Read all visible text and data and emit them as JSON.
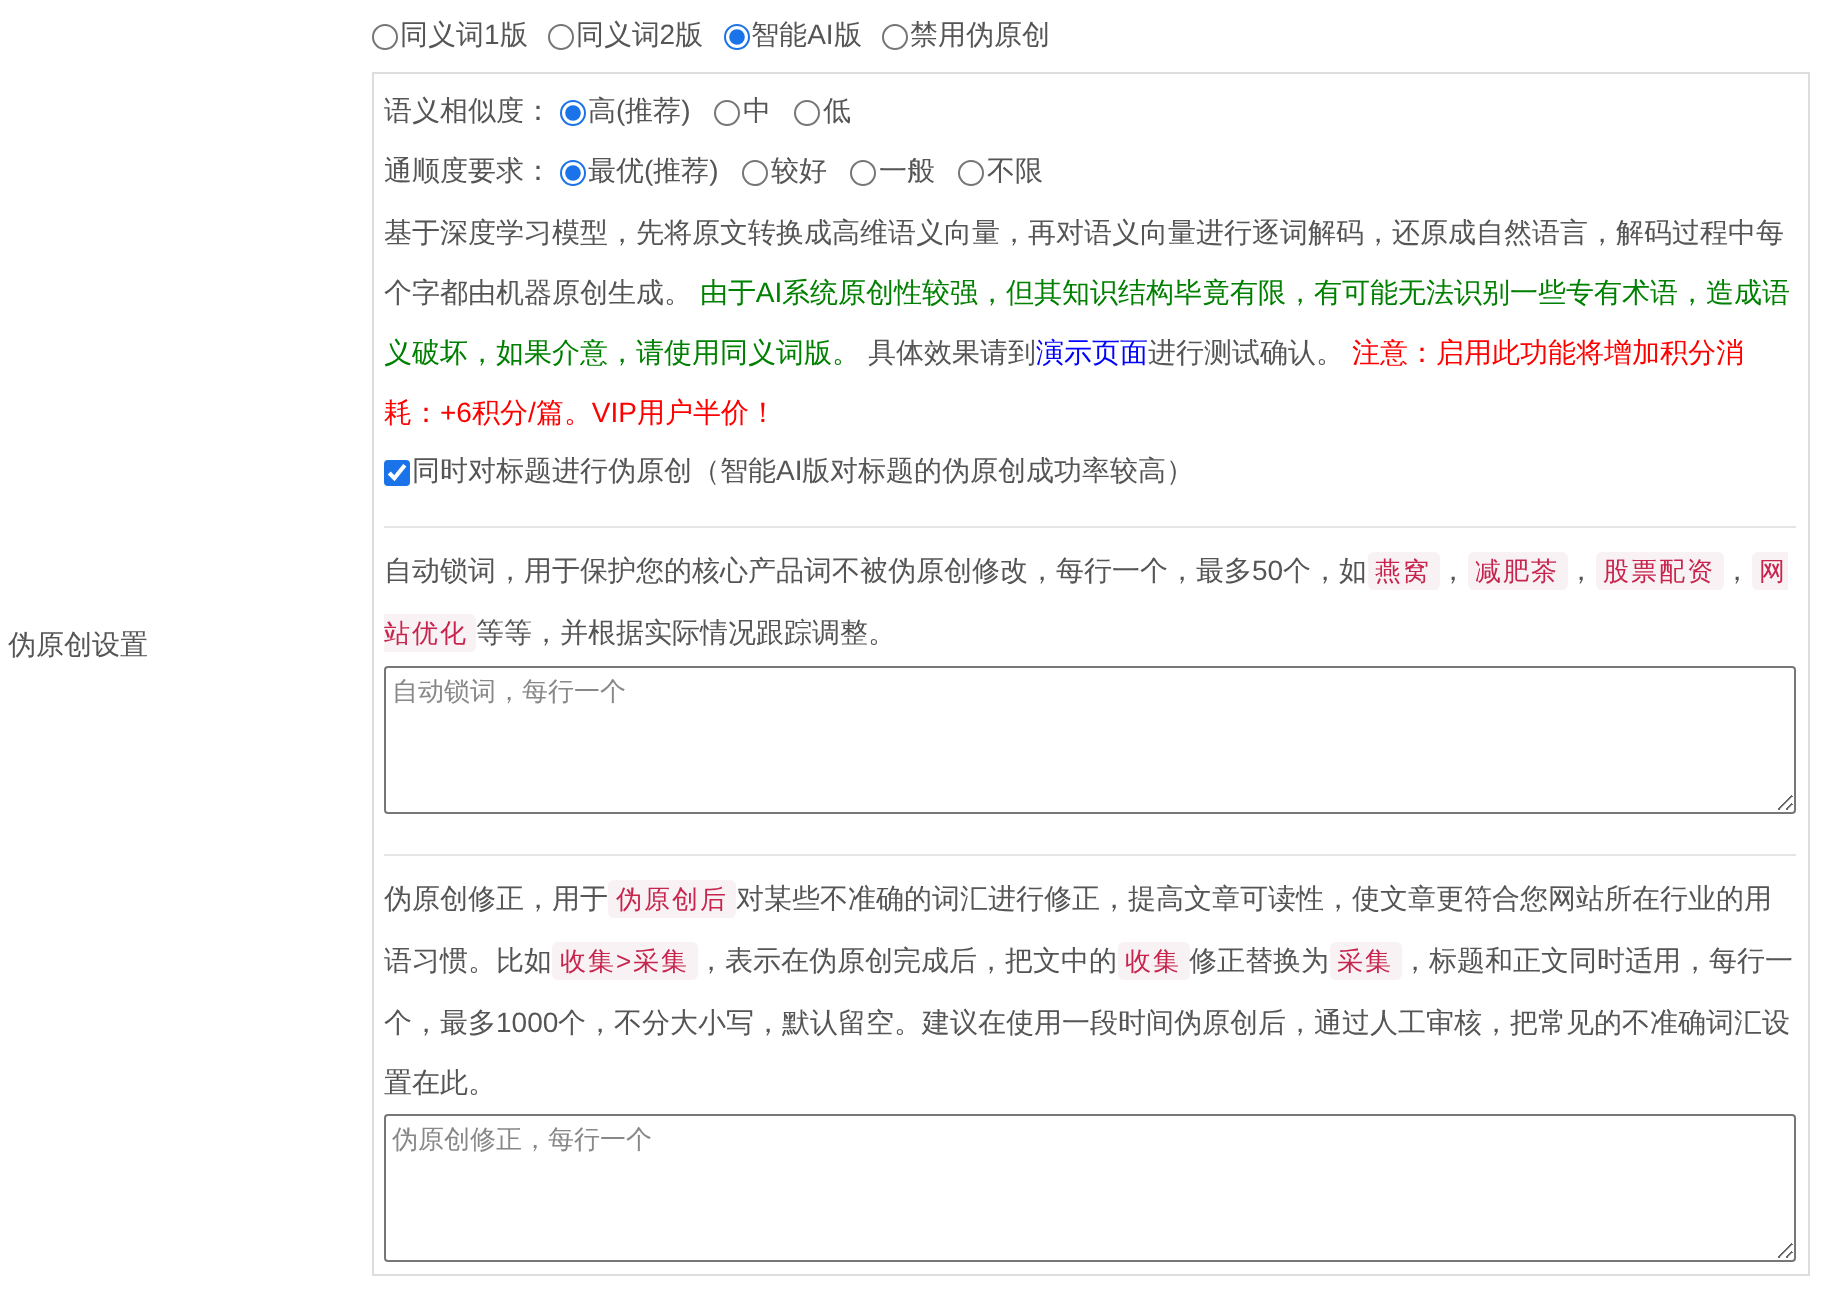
{
  "modes": [
    {
      "label": "同义词1版",
      "selected": false
    },
    {
      "label": "同义词2版",
      "selected": false
    },
    {
      "label": "智能AI版",
      "selected": true
    },
    {
      "label": "禁用伪原创",
      "selected": false
    }
  ],
  "settings_label": "伪原创设置",
  "similarity": {
    "label": "语义相似度：",
    "options": [
      {
        "label": "高(推荐)",
        "selected": true
      },
      {
        "label": "中",
        "selected": false
      },
      {
        "label": "低",
        "selected": false
      }
    ]
  },
  "fluency": {
    "label": "通顺度要求：",
    "options": [
      {
        "label": "最优(推荐)",
        "selected": true
      },
      {
        "label": "较好",
        "selected": false
      },
      {
        "label": "一般",
        "selected": false
      },
      {
        "label": "不限",
        "selected": false
      }
    ]
  },
  "description": [
    {
      "kind": "plain",
      "text": "基于深度学习模型，先将原文转换成高维语义向量，再对语义向量进行逐词解码，还原成自然语言，解码过程中每个字都由机器原创生成。 "
    },
    {
      "kind": "green",
      "text": "由于AI系统原创性较强，但其知识结构毕竟有限，有可能无法识别一些专有术语，造成语义破坏，如果介意，请使用同义词版。"
    },
    {
      "kind": "plain",
      "text": " 具体效果请到"
    },
    {
      "kind": "link",
      "text": "演示页面"
    },
    {
      "kind": "plain",
      "text": "进行测试确认。 "
    },
    {
      "kind": "red",
      "text": "注意：启用此功能将增加积分消耗：+6积分/篇。VIP用户半价！"
    }
  ],
  "title_option": {
    "label": "同时对标题进行伪原创（智能AI版对标题的伪原创成功率较高）",
    "checked": true
  },
  "lock_words": {
    "description": [
      {
        "kind": "plain",
        "text": "自动锁词，用于保护您的核心产品词不被伪原创修改，每行一个，最多50个，如"
      },
      {
        "kind": "code",
        "text": "燕窝"
      },
      {
        "kind": "plain",
        "text": "，"
      },
      {
        "kind": "code",
        "text": "减肥茶"
      },
      {
        "kind": "plain",
        "text": "，"
      },
      {
        "kind": "code",
        "text": "股票配资"
      },
      {
        "kind": "plain",
        "text": "，"
      },
      {
        "kind": "code",
        "text": "网站优化"
      },
      {
        "kind": "plain",
        "text": "等等，并根据实际情况跟踪调整。"
      }
    ],
    "placeholder": "自动锁词，每行一个"
  },
  "correction": {
    "description": [
      {
        "kind": "plain",
        "text": "伪原创修正，用于"
      },
      {
        "kind": "code",
        "text": "伪原创后"
      },
      {
        "kind": "plain",
        "text": "对某些不准确的词汇进行修正，提高文章可读性，使文章更符合您网站所在行业的用语习惯。比如"
      },
      {
        "kind": "code",
        "text": "收集>采集"
      },
      {
        "kind": "plain",
        "text": "，表示在伪原创完成后，把文中的"
      },
      {
        "kind": "code",
        "text": "收集"
      },
      {
        "kind": "plain",
        "text": "修正替换为"
      },
      {
        "kind": "code",
        "text": "采集"
      },
      {
        "kind": "plain",
        "text": "，标题和正文同时适用，每行一个，最多1000个，不分大小写，默认留空。建议在使用一段时间伪原创后，通过人工审核，把常见的不准确词汇设置在此。"
      }
    ],
    "placeholder": "伪原创修正，每行一个"
  }
}
